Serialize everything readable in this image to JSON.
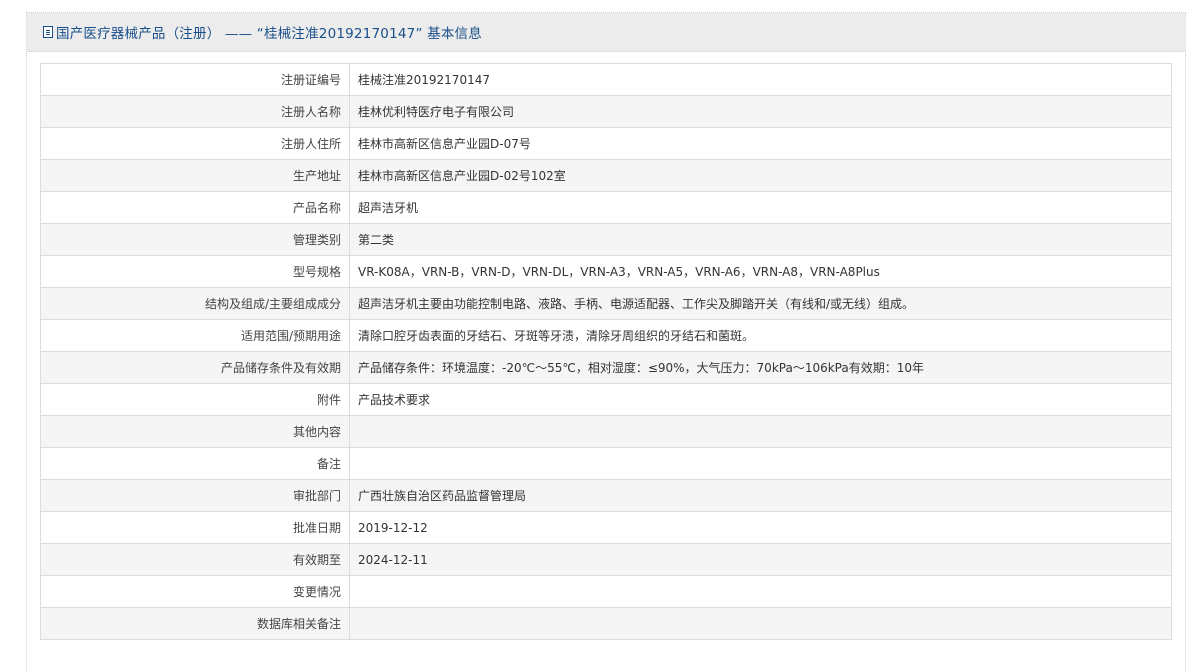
{
  "header": {
    "icon": "document-icon",
    "title": "国产医疗器械产品（注册） —— “桂械注准20192170147” 基本信息"
  },
  "rows": [
    {
      "label": "注册证编号",
      "value": "桂械注准20192170147"
    },
    {
      "label": "注册人名称",
      "value": "桂林优利特医疗电子有限公司"
    },
    {
      "label": "注册人住所",
      "value": "桂林市高新区信息产业园D-07号"
    },
    {
      "label": "生产地址",
      "value": "桂林市高新区信息产业园D-02号102室"
    },
    {
      "label": "产品名称",
      "value": "超声洁牙机"
    },
    {
      "label": "管理类别",
      "value": "第二类"
    },
    {
      "label": "型号规格",
      "value": "VR-K08A，VRN-B，VRN-D，VRN-DL，VRN-A3，VRN-A5，VRN-A6，VRN-A8，VRN-A8Plus"
    },
    {
      "label": "结构及组成/主要组成成分",
      "value": "超声洁牙机主要由功能控制电路、液路、手柄、电源适配器、工作尖及脚踏开关（有线和/或无线）组成。"
    },
    {
      "label": "适用范围/预期用途",
      "value": "清除口腔牙齿表面的牙结石、牙斑等牙渍，清除牙周组织的牙结石和菌斑。"
    },
    {
      "label": "产品储存条件及有效期",
      "value": "产品储存条件：环境温度：-20℃～55℃，相对湿度：≤90%，大气压力：70kPa～106kPa有效期：10年"
    },
    {
      "label": "附件",
      "value": "产品技术要求"
    },
    {
      "label": "其他内容",
      "value": ""
    },
    {
      "label": "备注",
      "value": ""
    },
    {
      "label": "审批部门",
      "value": "广西壮族自治区药品监督管理局"
    },
    {
      "label": "批准日期",
      "value": "2019-12-12"
    },
    {
      "label": "有效期至",
      "value": "2024-12-11"
    },
    {
      "label": "变更情况",
      "value": ""
    },
    {
      "label": "数据库相关备注",
      "value": ""
    }
  ]
}
